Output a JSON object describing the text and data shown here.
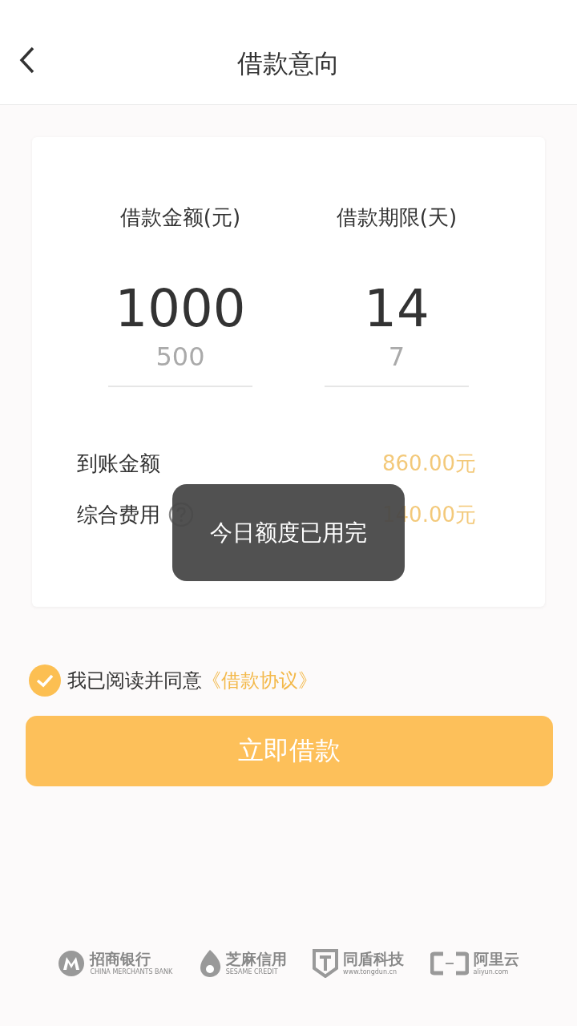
{
  "header": {
    "title": "借款意向"
  },
  "pickers": [
    {
      "label": "借款金额(元)",
      "options": [
        {
          "value": "1000",
          "selected": true
        },
        {
          "value": "500",
          "selected": false
        }
      ]
    },
    {
      "label": "借款期限(天)",
      "options": [
        {
          "value": "14",
          "selected": true
        },
        {
          "value": "7",
          "selected": false
        }
      ]
    }
  ],
  "summary": [
    {
      "label": "到账金额",
      "value": "860.00元",
      "help": false
    },
    {
      "label": "综合费用",
      "value": "140.00元",
      "help": true
    }
  ],
  "agreement": {
    "checked": true,
    "text": "我已阅读并同意",
    "link": "《借款协议》"
  },
  "submit": "立即借款",
  "toast": "今日额度已用完",
  "partners": [
    {
      "kind": "bank",
      "name": "招商银行",
      "sub": "CHINA MERCHANTS BANK"
    },
    {
      "kind": "sesame",
      "name": "芝麻信用",
      "sub": "SESAME CREDIT"
    },
    {
      "kind": "shield",
      "name": "同盾科技",
      "sub": "www.tongdun.cn"
    },
    {
      "kind": "cloud",
      "name": "阿里云",
      "sub": "aliyun.com"
    }
  ]
}
